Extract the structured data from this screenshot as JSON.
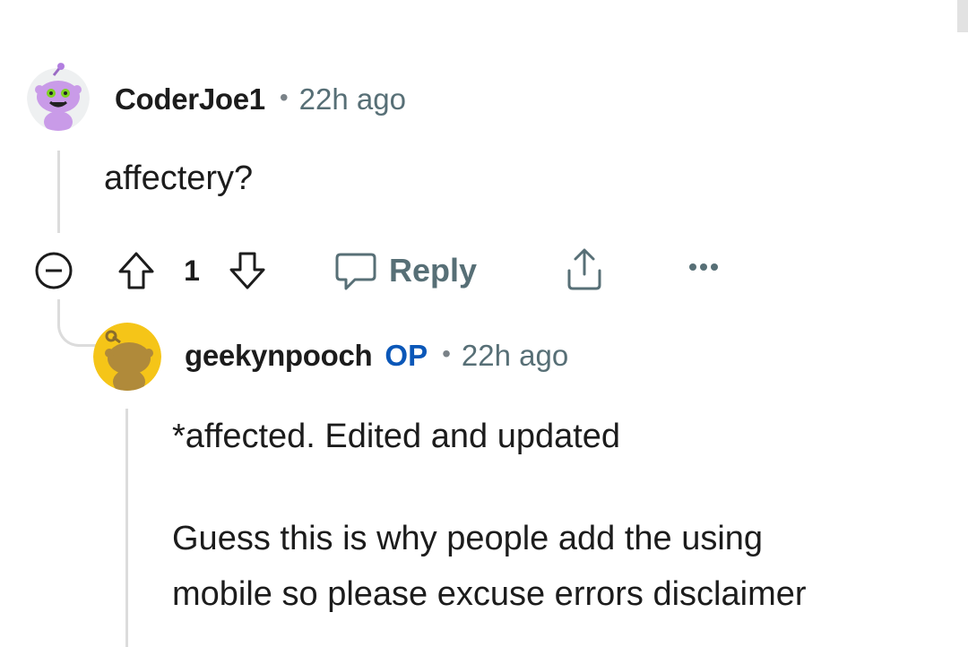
{
  "comment": {
    "username": "CoderJoe1",
    "separator": "•",
    "timestamp": "22h ago",
    "body": "affectery?",
    "score": "1",
    "reply_label": "Reply"
  },
  "reply": {
    "username": "geekynpooch",
    "op_badge": "OP",
    "separator": "•",
    "timestamp": "22h ago",
    "body_lines": [
      "*affected. Edited and updated",
      "Guess this is why people add the using",
      "mobile so please excuse errors disclaimer"
    ]
  },
  "colors": {
    "op_badge": "#0a57b8",
    "meta_text": "#576f76",
    "thread_line": "#dcdcdc",
    "avatar1_bg": "#c99be8",
    "avatar2_bg": "#f5c518"
  },
  "icons": [
    "collapse-icon",
    "upvote-icon",
    "downvote-icon",
    "reply-icon",
    "share-icon",
    "more-icon"
  ]
}
